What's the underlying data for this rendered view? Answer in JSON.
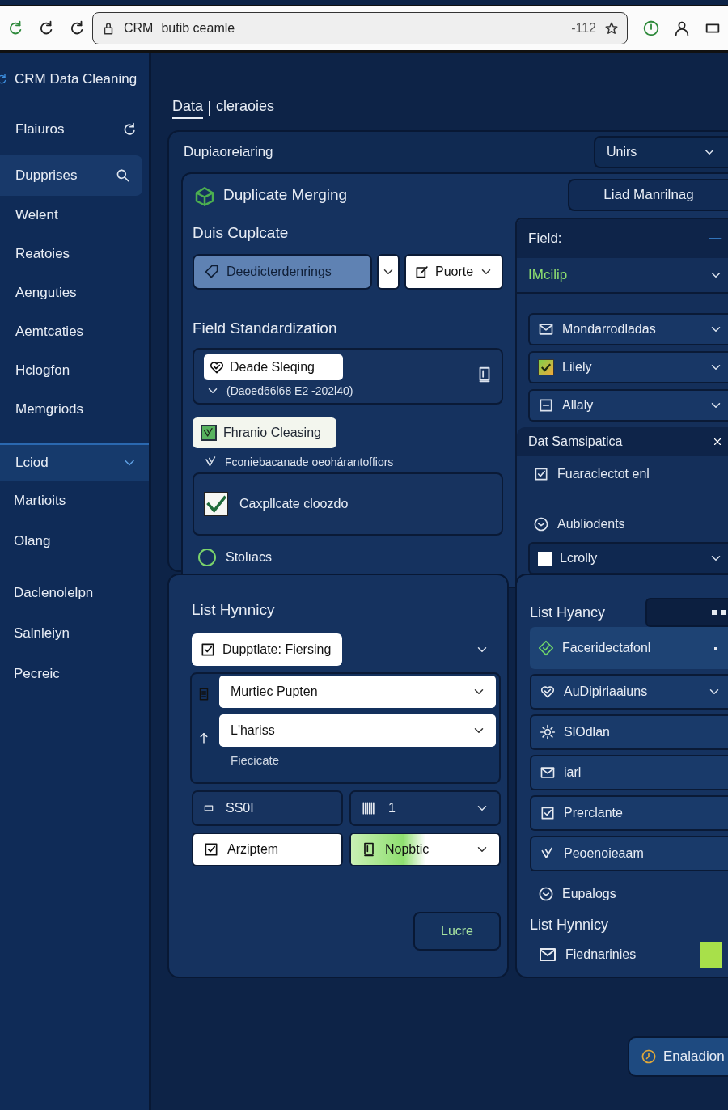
{
  "browser": {
    "site": "CRM",
    "address": "butib ceamle",
    "zoom": "-112"
  },
  "sidebar": {
    "title": "CRM Data Cleaning",
    "tools": [
      {
        "label": "Flaiuros",
        "selected": false
      },
      {
        "label": "Dupprises",
        "selected": true
      }
    ],
    "items": [
      {
        "label": "Welent",
        "selected": false
      },
      {
        "label": "Reatoies",
        "selected": false
      },
      {
        "label": "Aenguties",
        "selected": false
      },
      {
        "label": "Aemtcaties",
        "selected": false
      },
      {
        "label": "Hclogfon",
        "selected": false
      },
      {
        "label": "Memgriods",
        "selected": false
      }
    ],
    "group": {
      "label": "Lciod",
      "expanded": true
    },
    "group_items": [
      {
        "label": "Martioits",
        "selected": false
      },
      {
        "label": "Olang",
        "selected": false
      },
      {
        "label": "Daclenolelpn",
        "selected": false
      },
      {
        "label": "Salnleiyn",
        "selected": false
      },
      {
        "label": "Pecreic",
        "selected": false
      }
    ]
  },
  "breadcrumb": [
    {
      "label": "Data",
      "selected": true
    },
    {
      "label": "cleraoies",
      "selected": false
    }
  ],
  "section": {
    "title": "Dupiaoreiaring",
    "select": "Unirs"
  },
  "card": {
    "title": "Duplicate Merging",
    "button": "Liad Manrilnag",
    "left": {
      "heading": "Duis Cuplcate",
      "field": "Deedicterdenrings",
      "button": "Puorte",
      "heading2": "Field Standardization",
      "chip": "Deade Sleqing",
      "chip_note": "(Daoed66l68 E2 -202l40)",
      "option": {
        "label": "Fhranio Cleasing",
        "checked": true
      },
      "option_note": "Fconiebacanade oeohárantoffiors",
      "confirm": {
        "label": "Caxpllcate cloozdo",
        "checked": true
      },
      "radio": {
        "label": "Stolıacs",
        "selected": false
      }
    },
    "right": {
      "heading": "Field:",
      "select": "IMcilip",
      "rows": [
        {
          "label": "Mondarrodladas",
          "kind": "mail"
        },
        {
          "label": "Lilely",
          "kind": "check",
          "checked": true
        },
        {
          "label": "Allaly",
          "kind": "minus"
        }
      ],
      "heading2": "Dat Samsipatica",
      "items": [
        {
          "label": "Fuaraclectot enl"
        },
        {
          "label": "Aubliodents"
        }
      ],
      "select2": {
        "label": "Lcrolly",
        "checked": false
      }
    }
  },
  "lower_left": {
    "heading": "List Hynnicy",
    "chip": {
      "label": "Dupptlate: Fiersing",
      "checked": true
    },
    "selects": [
      "Murtiec Pupten",
      "L'hariss"
    ],
    "note": "Fiecicate",
    "field": "SS0I",
    "count": "1",
    "option": {
      "label": "Arziptem",
      "checked": true
    },
    "progress": {
      "label": "Nopbtic",
      "level": 0.5
    },
    "button": "Lucre"
  },
  "lower_right": {
    "heading": "List Hyancy",
    "items": [
      {
        "label": "Faceridectafonl",
        "kind": "tile"
      },
      {
        "label": "AuDipiriaaiuns",
        "kind": "select"
      },
      {
        "label": "SlOdlan",
        "kind": "row"
      },
      {
        "label": "iarl",
        "kind": "row"
      },
      {
        "label": "Prerclante",
        "kind": "row"
      },
      {
        "label": "Peoenoieaam",
        "kind": "row"
      },
      {
        "label": "Eupalogs",
        "kind": "plain"
      }
    ],
    "heading2": "List Hynnicy",
    "last": "Fiednarinies"
  },
  "action": "Enaladion"
}
